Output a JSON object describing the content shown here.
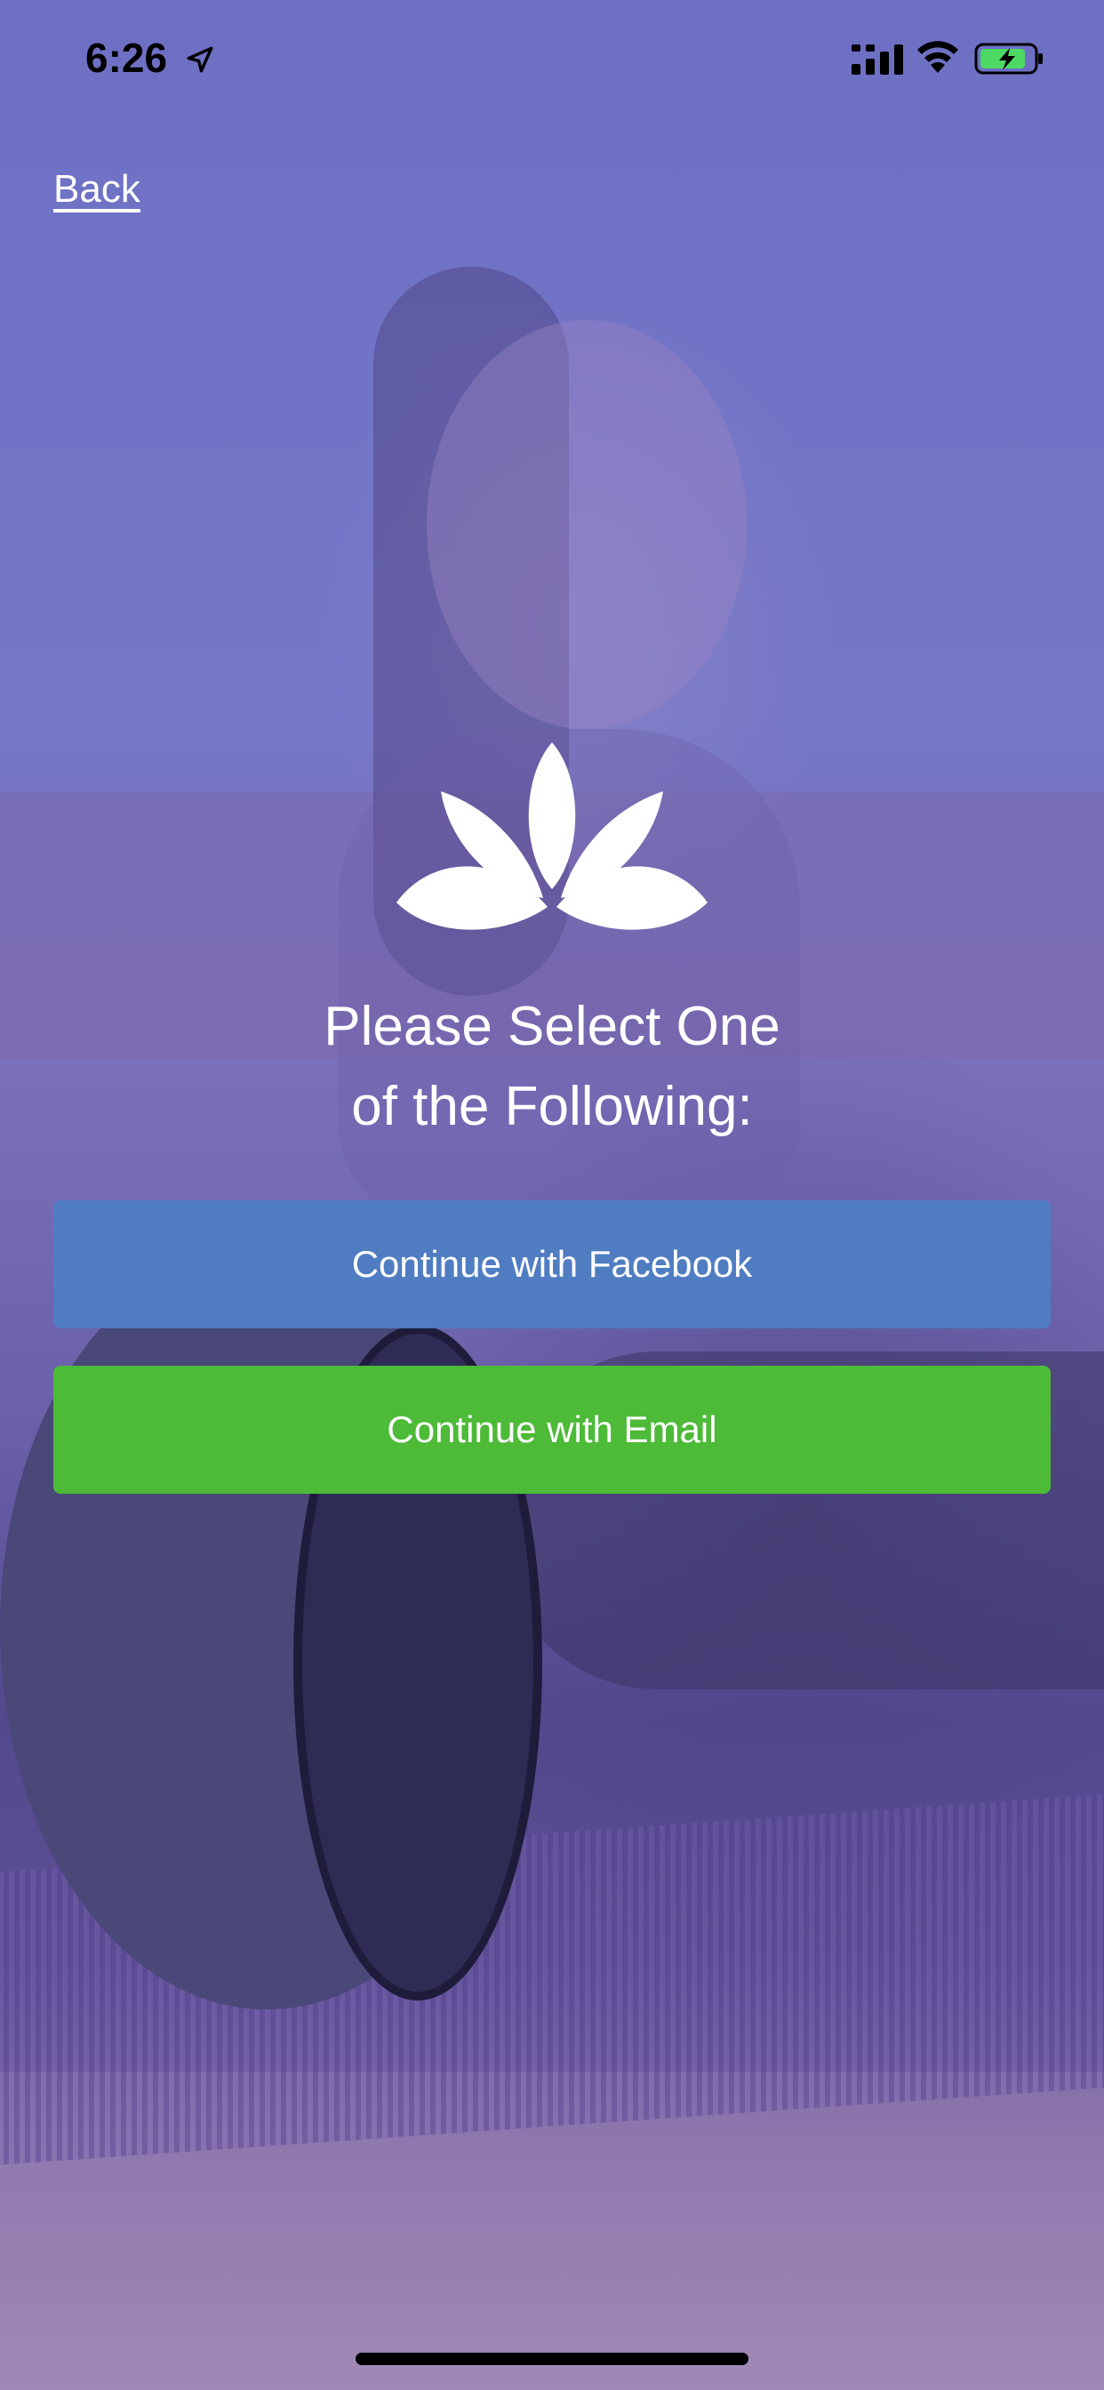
{
  "status_bar": {
    "time": "6:26"
  },
  "nav": {
    "back_label": "Back"
  },
  "main": {
    "title_line1": "Please Select One",
    "title_line2": "of the Following:",
    "facebook_button_label": "Continue with Facebook",
    "email_button_label": "Continue with Email"
  },
  "colors": {
    "facebook_button": "#507dc2",
    "email_button": "#4dba38",
    "overlay": "#6d70c4"
  },
  "icons": {
    "location": "location-arrow-icon",
    "signal": "cellular-signal-icon",
    "wifi": "wifi-icon",
    "battery": "battery-charging-icon",
    "logo": "lotus-logo-icon"
  }
}
